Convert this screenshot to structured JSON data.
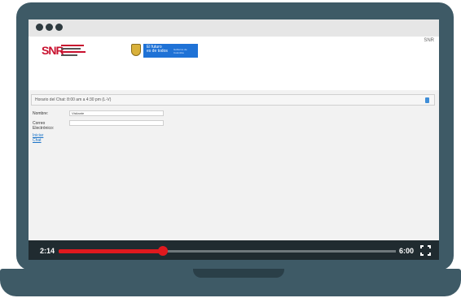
{
  "page_header": {
    "brand_left": "SNR",
    "brand_left_lines": [
      "SUPERINTENDENCIA",
      "DE NOTARIADO",
      "& REGISTRO"
    ],
    "gov_line1": "El futuro",
    "gov_line2": "es de todos",
    "gov_sub": "Gobierno de Colombia",
    "right_text": "SNR"
  },
  "chat_bar": {
    "schedule": "Horario del Chat: 8:00 am a 4:30 pm (L-V)"
  },
  "form": {
    "name_label": "Nombre:",
    "name_value": "Visitante",
    "email_label": "Correo Electrónico:",
    "email_value": "",
    "start_link": "Iniciar Chat"
  },
  "video": {
    "current_time": "2:14",
    "duration": "6:00",
    "progress_fraction": 0.31
  },
  "colors": {
    "laptop": "#3e5a66",
    "accent_red": "#e0191e",
    "link_blue": "#1a73c8",
    "gov_blue": "#1f72d6"
  }
}
